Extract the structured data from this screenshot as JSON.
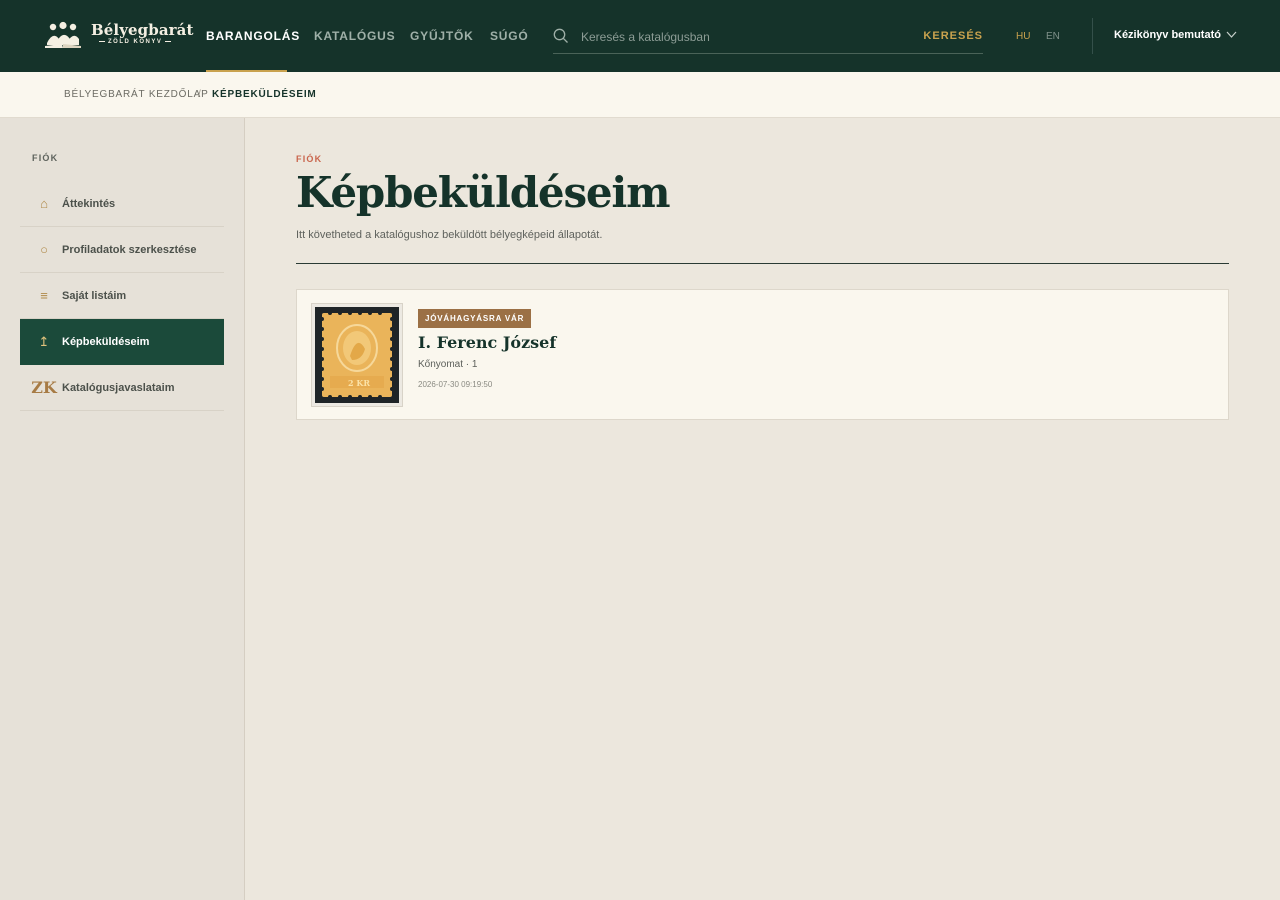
{
  "brand": {
    "title": "Bélyegbarát",
    "subtitle": "ZÖLD KÖNYV"
  },
  "nav": {
    "items": [
      {
        "label": "Barangolás",
        "active": true
      },
      {
        "label": "Katalógus",
        "active": false
      },
      {
        "label": "Gyűjtők",
        "active": false
      },
      {
        "label": "Súgó",
        "active": false
      }
    ]
  },
  "search": {
    "placeholder": "Keresés a katalógusban",
    "button_label": "KERESÉS",
    "icon": "search-icon"
  },
  "languages": [
    {
      "code": "HU",
      "active": true
    },
    {
      "code": "EN",
      "active": false
    }
  ],
  "user_menu": {
    "label": "Kézikönyv bemutató",
    "icon": "chevron-down-icon"
  },
  "breadcrumb": {
    "home": "Bélyegbarát kezdőlap",
    "separator": "/",
    "current": "Képbeküldéseim"
  },
  "sidebar": {
    "heading": "FIÓK",
    "items": [
      {
        "label": "Áttekintés",
        "icon": "home-icon",
        "glyph": "⌂",
        "active": false
      },
      {
        "label": "Profiladatok szerkesztése",
        "icon": "profile-icon",
        "glyph": "○",
        "active": false
      },
      {
        "label": "Saját listáim",
        "icon": "list-icon",
        "glyph": "≡",
        "active": false
      },
      {
        "label": "Képbeküldéseim",
        "icon": "upload-icon",
        "glyph": "↥",
        "active": true
      },
      {
        "label": "Katalógusjavaslataim",
        "icon": "zk-monogram-icon",
        "glyph": "ZK",
        "active": false
      }
    ]
  },
  "main": {
    "eyebrow": "FIÓK",
    "title": "Képbeküldéseim",
    "description": "Itt követheted a katalógushoz beküldött bélyegképeid állapotát."
  },
  "submissions": [
    {
      "status": "JÓVÁHAGYÁSRA VÁR",
      "title": "I. Ferenc József",
      "meta": "Kőnyomat · 1",
      "date": "2026-07-30 09:19:50",
      "stamp_text": "2 KR"
    }
  ],
  "colors": {
    "header_bg": "#15332a",
    "accent_gold": "#c9a24e",
    "active_sidebar": "#1b4a3a",
    "badge": "#9b7045",
    "eyebrow": "#c9654c"
  }
}
